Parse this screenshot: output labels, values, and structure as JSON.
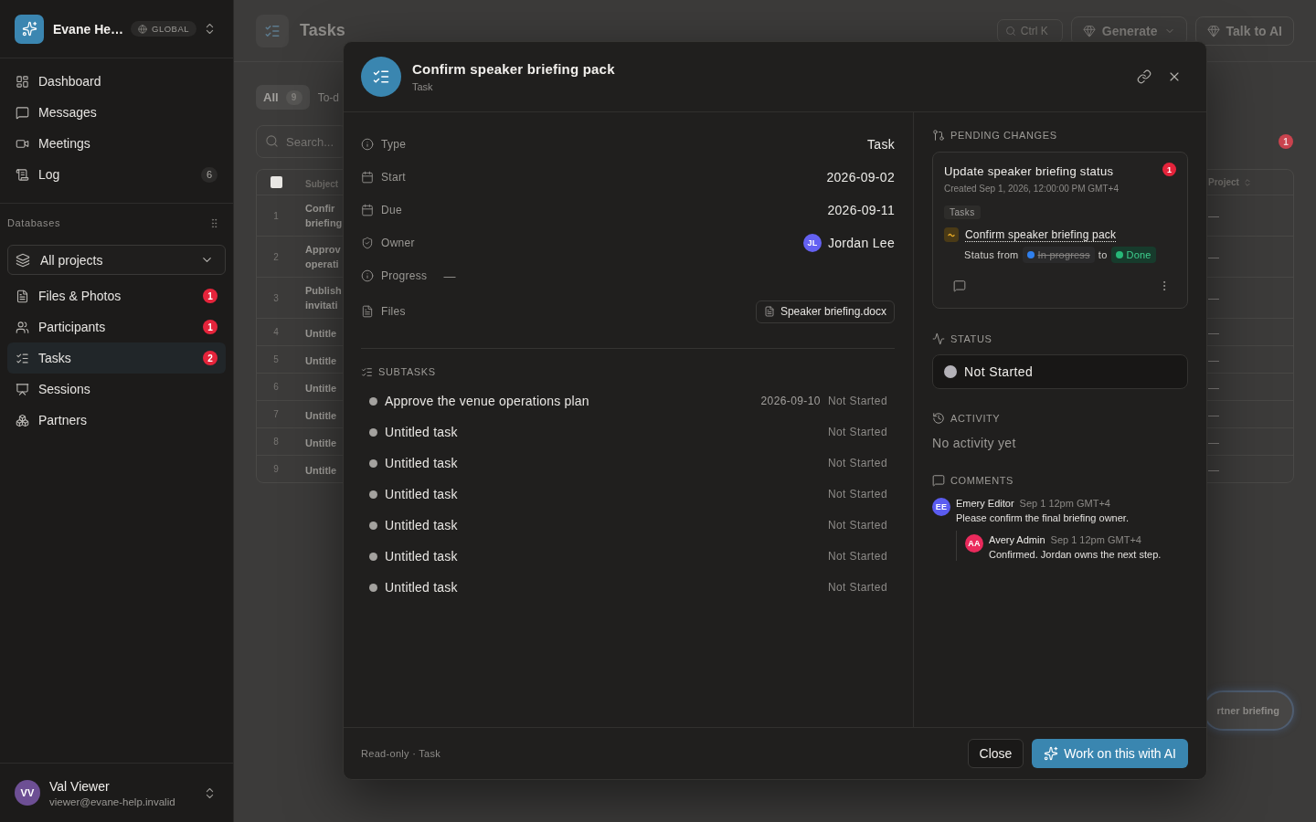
{
  "sidebar": {
    "workspace": {
      "name": "Evane He…",
      "scope": "GLOBAL"
    },
    "nav": [
      {
        "label": "Dashboard",
        "selected": false
      },
      {
        "label": "Messages",
        "selected": false
      },
      {
        "label": "Meetings",
        "selected": false
      },
      {
        "label": "Log",
        "selected": false,
        "count": "6"
      }
    ],
    "databases": {
      "heading": "Databases",
      "filter": "All projects",
      "items": [
        {
          "label": "Files & Photos",
          "selected": false,
          "badge": "1"
        },
        {
          "label": "Participants",
          "selected": false,
          "badge": "1"
        },
        {
          "label": "Tasks",
          "selected": true,
          "badge": "2"
        },
        {
          "label": "Sessions",
          "selected": false
        },
        {
          "label": "Partners",
          "selected": false
        }
      ]
    },
    "user": {
      "initials": "VV",
      "color": "#6d4f94",
      "name": "Val Viewer",
      "email": "viewer@evane-help.invalid"
    }
  },
  "page": {
    "title": "Tasks",
    "search_shortcut": "Ctrl K",
    "buttons": [
      {
        "label": "Generate",
        "kind": "menu"
      },
      {
        "label": "Talk to AI",
        "kind": "plain"
      }
    ],
    "tabs": [
      {
        "label": "All",
        "count": "9",
        "selected": true
      },
      {
        "label": "To-d",
        "selected": false
      }
    ],
    "search": {
      "placeholder": "Search..."
    },
    "alert_badge": "1",
    "table": {
      "select_all_checked": false,
      "columns": [
        "Subject",
        "Project"
      ],
      "rows": [
        {
          "number": "1",
          "subject": [
            "Confir",
            "briefing"
          ],
          "project": "—"
        },
        {
          "number": "2",
          "subject": [
            "Approv",
            "operati"
          ],
          "project": "—"
        },
        {
          "number": "3",
          "subject": [
            "Publish",
            "invitati"
          ],
          "project": "—"
        },
        {
          "number": "4",
          "subject": [
            "Untitle"
          ],
          "project": "—"
        },
        {
          "number": "5",
          "subject": [
            "Untitle"
          ],
          "project": "—"
        },
        {
          "number": "6",
          "subject": [
            "Untitle"
          ],
          "project": "—"
        },
        {
          "number": "7",
          "subject": [
            "Untitle"
          ],
          "project": "—"
        },
        {
          "number": "8",
          "subject": [
            "Untitle"
          ],
          "project": "—"
        },
        {
          "number": "9",
          "subject": [
            "Untitle"
          ],
          "project": "—"
        }
      ]
    },
    "floating_chip": "rtner briefing"
  },
  "dialog": {
    "title": "Confirm speaker briefing pack",
    "subtitle": "Task",
    "properties": [
      {
        "label": "Type",
        "kind": "text",
        "value": "Task"
      },
      {
        "label": "Start",
        "kind": "text",
        "value": "2026-09-02"
      },
      {
        "label": "Due",
        "kind": "text",
        "value": "2026-09-11"
      },
      {
        "label": "Owner",
        "kind": "person",
        "value": "Jordan Lee",
        "initials": "JL",
        "color": "#6461f2"
      },
      {
        "label": "Progress",
        "kind": "empty",
        "value": "—"
      },
      {
        "label": "Files",
        "kind": "file",
        "value": "Speaker briefing.docx"
      }
    ],
    "subtasks": {
      "heading": "SUBTASKS",
      "items": [
        {
          "title": "Approve the venue operations plan",
          "date": "2026-09-10",
          "status": "Not Started"
        },
        {
          "title": "Untitled task",
          "status": "Not Started"
        },
        {
          "title": "Untitled task",
          "status": "Not Started"
        },
        {
          "title": "Untitled task",
          "status": "Not Started"
        },
        {
          "title": "Untitled task",
          "status": "Not Started"
        },
        {
          "title": "Untitled task",
          "status": "Not Started"
        },
        {
          "title": "Untitled task",
          "status": "Not Started"
        }
      ]
    },
    "pending_changes": {
      "heading": "PENDING CHANGES",
      "changes": [
        {
          "title": "Update speaker briefing status",
          "badge": "1",
          "created": "Created Sep 1, 2026, 12:00:00 PM GMT+4",
          "tag": "Tasks",
          "record": "Confirm speaker briefing pack",
          "field": "Status from",
          "from": {
            "label": "In progress",
            "color": "#2f80ed"
          },
          "joiner": "to",
          "to": {
            "label": "Done",
            "color": "#27b878"
          }
        }
      ]
    },
    "status": {
      "heading": "STATUS",
      "value": "Not Started"
    },
    "activity": {
      "heading": "ACTIVITY",
      "empty_text": "No activity yet"
    },
    "comments": {
      "heading": "COMMENTS",
      "items": [
        {
          "initials": "EE",
          "color": "#5b5cf0",
          "author": "Emery Editor",
          "time": "Sep 1 12pm GMT+4",
          "text": "Please confirm the final briefing owner.",
          "children": [
            {
              "initials": "AA",
              "color": "#ea2a5c",
              "author": "Avery Admin",
              "time": "Sep 1 12pm GMT+4",
              "text": "Confirmed. Jordan owns the next step."
            }
          ]
        }
      ]
    },
    "footer": {
      "note": "Read-only · Task",
      "buttons": [
        {
          "label": "Close",
          "kind": "secondary"
        },
        {
          "label": "Work on this with AI",
          "kind": "primary"
        }
      ]
    }
  }
}
